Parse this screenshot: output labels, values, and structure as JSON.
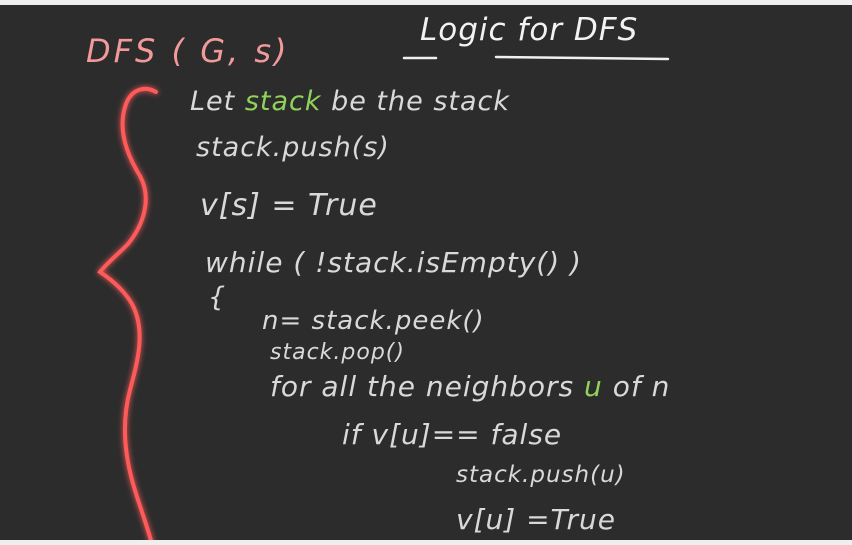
{
  "slide": {
    "title": "Logic for DFS",
    "heading": "DFS ( G, s)",
    "lines": {
      "l1_pre": "Let ",
      "l1_var": "stack",
      "l1_post": " be the stack",
      "l2": "stack.push(s)",
      "l3": "v[s] = True",
      "l4": "while ( !stack.isEmpty() )",
      "l5": "{",
      "l6": "n= stack.peek()",
      "l7": "stack.pop()",
      "l8_pre": "for all the neighbors ",
      "l8_var": "u",
      "l8_post": " of n",
      "l9": "if  v[u]== false",
      "l10": "stack.push(u)",
      "l11": "v[u] =True"
    }
  },
  "colors": {
    "board": "#2c2c2c",
    "chalk": "#d9d9d9",
    "heading_pink": "#f29a9a",
    "highlight_green": "#8fd35a",
    "brace_red": "#ff4a4a"
  }
}
